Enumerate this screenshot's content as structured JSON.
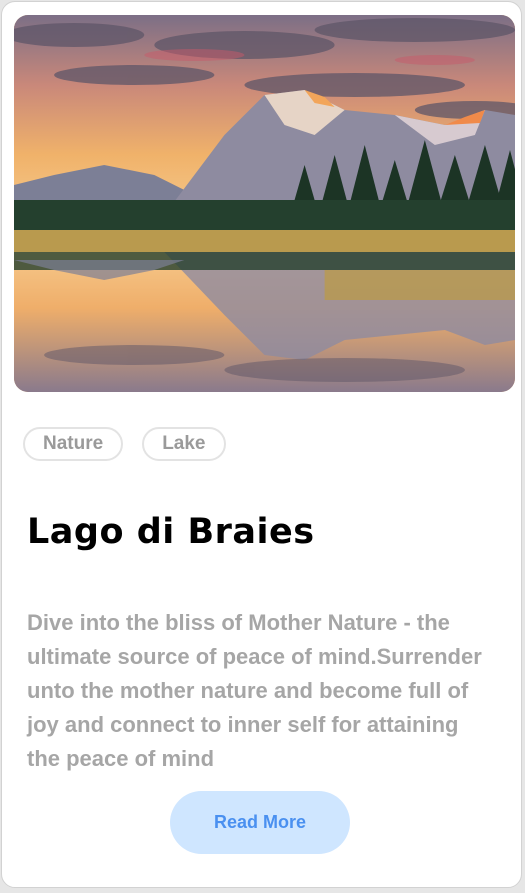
{
  "card": {
    "image_alt": "Mountain lake at sunset with reflection",
    "tags": [
      "Nature",
      "Lake"
    ],
    "title": "Lago di Braies",
    "description": "Dive into the bliss of Mother Nature - the ultimate source of peace of mind.Surrender unto the mother nature and become full of joy and connect to inner self for attaining the peace of mind",
    "button_label": "Read More"
  },
  "colors": {
    "button_bg": "#cfe6ff",
    "button_text": "#4a90f0",
    "tag_text": "#9a9a9a",
    "description_text": "#a6a6a6"
  }
}
